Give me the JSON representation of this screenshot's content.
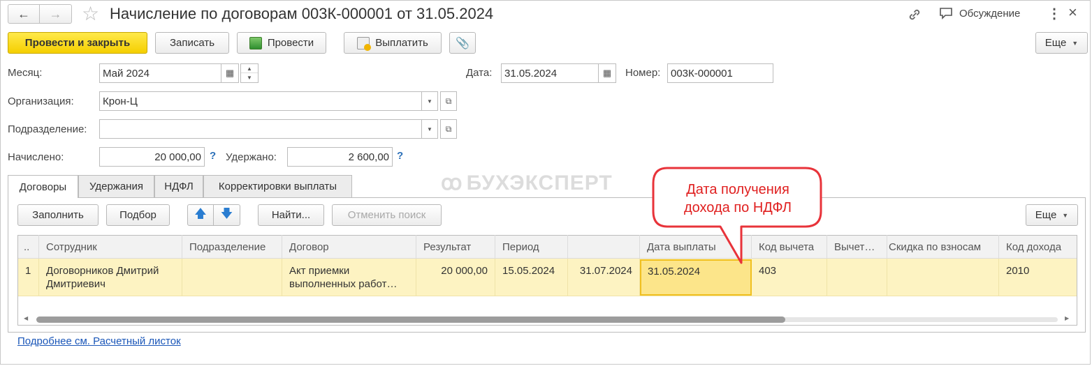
{
  "window": {
    "title": "Начисление по договорам 003К-000001 от 31.05.2024",
    "discussion_label": "Обсуждение"
  },
  "toolbar": {
    "post_close": "Провести и закрыть",
    "save": "Записать",
    "post": "Провести",
    "pay": "Выплатить",
    "more": "Еще"
  },
  "form": {
    "month_label": "Месяц:",
    "month_value": "Май 2024",
    "date_label": "Дата:",
    "date_value": "31.05.2024",
    "number_label": "Номер:",
    "number_value": "003К-000001",
    "org_label": "Организация:",
    "org_value": "Крон-Ц",
    "dept_label": "Подразделение:",
    "dept_value": "",
    "accrued_label": "Начислено:",
    "accrued_value": "20 000,00",
    "withheld_label": "Удержано:",
    "withheld_value": "2 600,00"
  },
  "tabs": [
    {
      "label": "Договоры"
    },
    {
      "label": "Удержания"
    },
    {
      "label": "НДФЛ"
    },
    {
      "label": "Корректировки выплаты"
    }
  ],
  "table_toolbar": {
    "fill": "Заполнить",
    "select": "Подбор",
    "find": "Найти...",
    "cancel_search": "Отменить поиск",
    "more": "Еще"
  },
  "table": {
    "columns": [
      "..",
      "Сотрудник",
      "Подразделение",
      "Договор",
      "Результат",
      "Период",
      "",
      "Дата выплаты",
      "Код вычета",
      "Вычет…",
      "Скидка по взносам",
      "Код дохода"
    ],
    "rows": [
      [
        "1",
        "Договорников Дмитрий Дмитриевич",
        "",
        "Акт приемки выполненных работ…",
        "20 000,00",
        "15.05.2024",
        "31.07.2024",
        "31.05.2024",
        "403",
        "",
        "",
        "2010"
      ]
    ]
  },
  "watermark": "БУХЭКСПЕРТ",
  "callout": "Дата получения дохода по НДФЛ",
  "footer_link": "Подробнее см. Расчетный листок",
  "colors": {
    "accent_yellow": "#f5cf00",
    "selected_row": "#fdf3c2",
    "selected_cell": "#fce58a",
    "callout_border": "#e8333a",
    "link": "#1a56b8"
  }
}
